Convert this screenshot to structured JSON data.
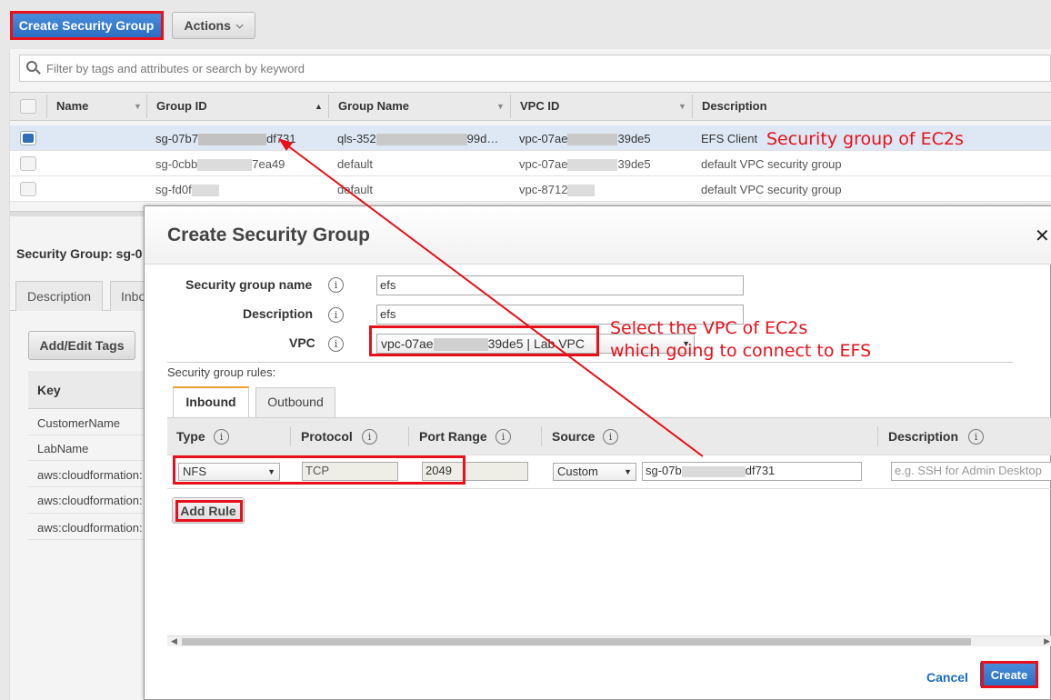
{
  "toolbar": {
    "create_label": "Create Security Group",
    "actions_label": "Actions"
  },
  "search": {
    "placeholder": "Filter by tags and attributes or search by keyword"
  },
  "table": {
    "headers": [
      "Name",
      "Group ID",
      "Group Name",
      "VPC ID",
      "Description"
    ],
    "rows": [
      {
        "name": "",
        "group_id_a": "sg-07b7",
        "group_id_b": "df731",
        "group_name_a": "qls-352",
        "group_name_b": "99d…",
        "vpc_a": "vpc-07ae",
        "vpc_b": "39de5",
        "description": "EFS Client"
      },
      {
        "name": "",
        "group_id_a": "sg-0cbb",
        "group_id_b": "7ea49",
        "group_name_a": "default",
        "group_name_b": "",
        "vpc_a": "vpc-07ae",
        "vpc_b": "39de5",
        "description": "default VPC security group"
      },
      {
        "name": "",
        "group_id_a": "sg-fd0f",
        "group_id_b": "",
        "group_name_a": "default",
        "group_name_b": "",
        "vpc_a": "vpc-8712",
        "vpc_b": "",
        "description": "default VPC security group"
      }
    ]
  },
  "details": {
    "title": "Security Group: sg-0",
    "tab_description": "Description",
    "tab_inbound": "Inbo",
    "add_tags_label": "Add/Edit Tags",
    "key_header": "Key",
    "keys": [
      "CustomerName",
      "LabName",
      "aws:cloudformation:",
      "aws:cloudformation:",
      "aws:cloudformation:"
    ]
  },
  "modal": {
    "title": "Create Security Group",
    "close_symbol": "✕",
    "name_label": "Security group name",
    "name_value": "efs",
    "desc_label": "Description",
    "desc_value": "efs",
    "vpc_label": "VPC",
    "vpc_value_a": "vpc-07ae",
    "vpc_value_b": "39de5 | Lab VPC",
    "rules_label": "Security group rules:",
    "tab_inbound": "Inbound",
    "tab_outbound": "Outbound",
    "col_type": "Type",
    "col_protocol": "Protocol",
    "col_port": "Port Range",
    "col_source": "Source",
    "col_description": "Description",
    "rule_type": "NFS",
    "rule_protocol": "TCP",
    "rule_port": "2049",
    "rule_source_type": "Custom",
    "rule_source_a": "sg-07b",
    "rule_source_b": "df731",
    "rule_desc_placeholder": "e.g. SSH for Admin Desktop",
    "add_rule_label": "Add Rule",
    "cancel_label": "Cancel",
    "create_label": "Create"
  },
  "annotations": {
    "sg_note": "Security group of EC2s",
    "vpc_note_1": "Select the VPC of EC2s",
    "vpc_note_2": "which going to connect to EFS",
    "color": "#e8101a"
  },
  "colors": {
    "primary_button": "#2e7bd4",
    "selected_row": "#dde8f4",
    "highlight": "#e8101a"
  }
}
